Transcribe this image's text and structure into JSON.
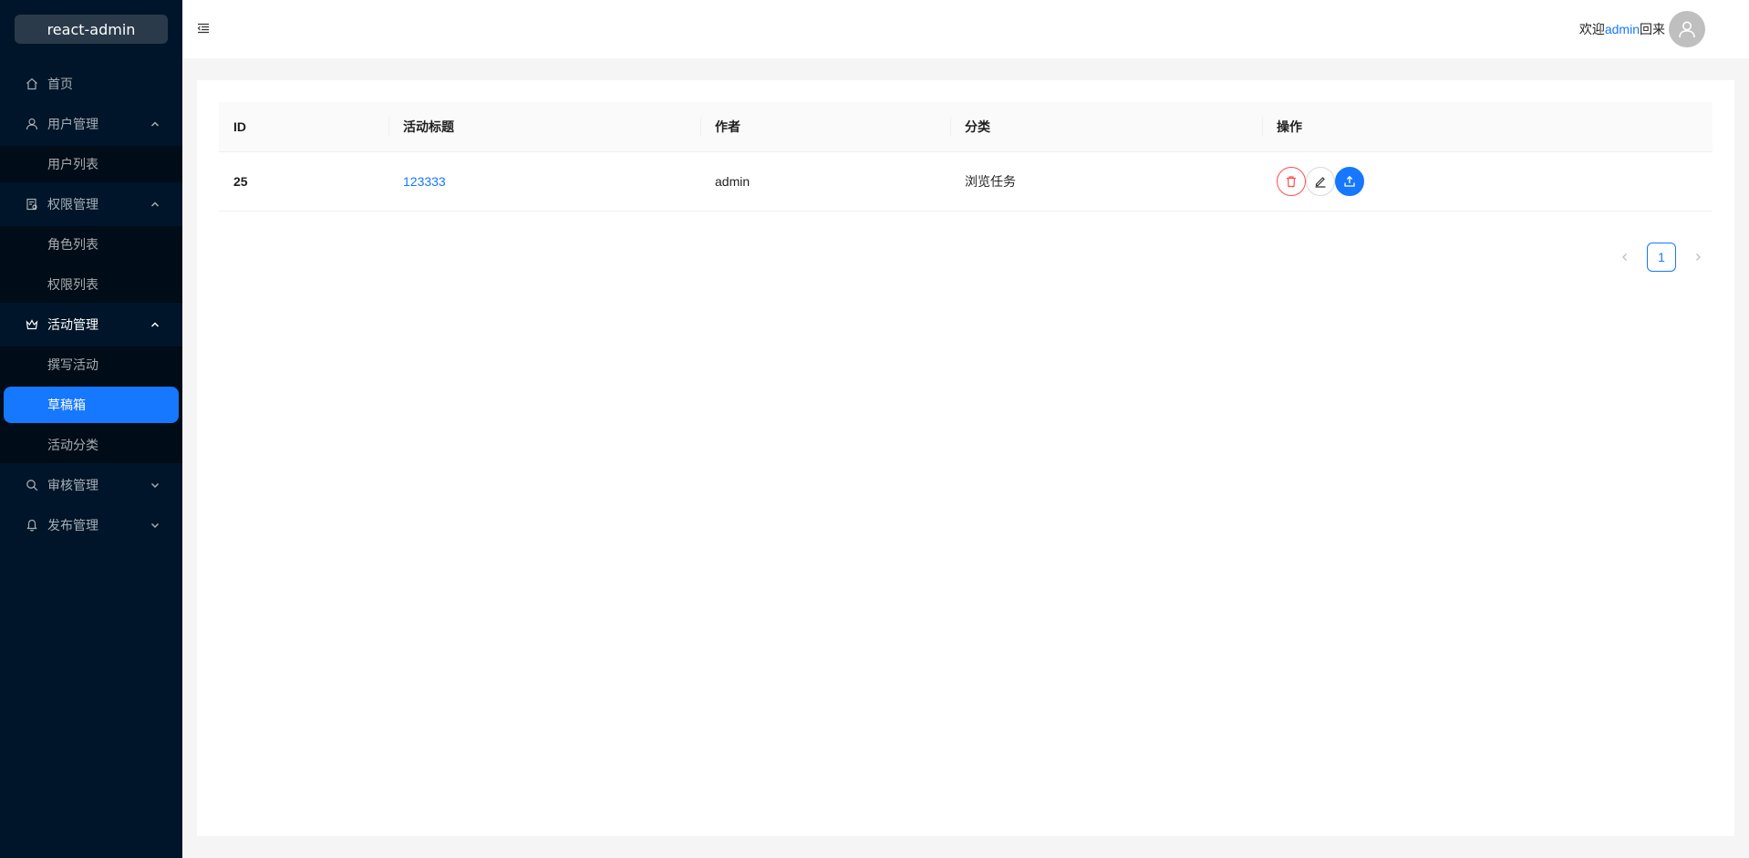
{
  "app": {
    "logo": "react-admin"
  },
  "sidebar": {
    "items": [
      {
        "label": "首页",
        "icon": "home-icon"
      },
      {
        "label": "用户管理",
        "icon": "user-icon",
        "open": true,
        "children": [
          {
            "label": "用户列表"
          }
        ]
      },
      {
        "label": "权限管理",
        "icon": "audit-icon",
        "open": true,
        "children": [
          {
            "label": "角色列表"
          },
          {
            "label": "权限列表"
          }
        ]
      },
      {
        "label": "活动管理",
        "icon": "crown-icon",
        "open": true,
        "children": [
          {
            "label": "撰写活动"
          },
          {
            "label": "草稿箱",
            "selected": true
          },
          {
            "label": "活动分类"
          }
        ]
      },
      {
        "label": "审核管理",
        "icon": "search-icon",
        "open": false
      },
      {
        "label": "发布管理",
        "icon": "bell-icon",
        "open": false
      }
    ]
  },
  "header": {
    "welcome_prefix": "欢迎",
    "username": "admin",
    "welcome_suffix": "回来"
  },
  "table": {
    "columns": [
      "ID",
      "活动标题",
      "作者",
      "分类",
      "操作"
    ],
    "rows": [
      {
        "id": "25",
        "title": "123333",
        "author": "admin",
        "category": "浏览任务"
      }
    ]
  },
  "pagination": {
    "current": "1"
  },
  "colors": {
    "sidebar_bg": "#001529",
    "submenu_bg": "#000c17",
    "primary": "#1677ff",
    "danger": "#ff4d4f"
  }
}
